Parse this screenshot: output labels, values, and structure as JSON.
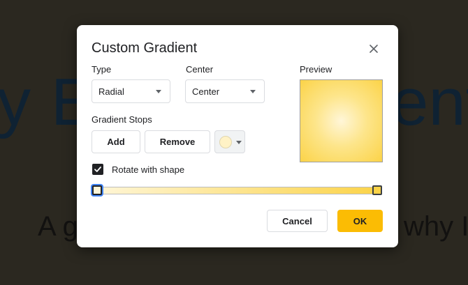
{
  "background": {
    "title_left": "y E",
    "title_right": "ent",
    "subtitle_left": "A g",
    "subtitle_right": "why I"
  },
  "dialog": {
    "title": "Custom Gradient",
    "close_icon": "close-icon",
    "type": {
      "label": "Type",
      "value": "Radial"
    },
    "center": {
      "label": "Center",
      "value": "Center"
    },
    "preview_label": "Preview",
    "stops": {
      "label": "Gradient Stops",
      "add_label": "Add",
      "remove_label": "Remove",
      "selected_color": "#fff2c6",
      "start_color": "#fff6d8",
      "end_color": "#fbd348"
    },
    "rotate": {
      "label": "Rotate with shape",
      "checked": true
    },
    "cancel_label": "Cancel",
    "ok_label": "OK"
  },
  "colors": {
    "accent": "#fbbc04",
    "focus": "#4285f4"
  }
}
